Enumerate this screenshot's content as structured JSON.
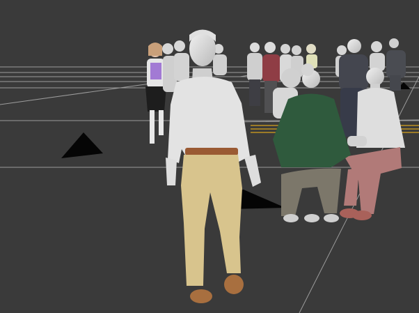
{
  "viewport": {
    "background_color": "#3a3a3a",
    "grid_color": "#bdbdbd",
    "selected_grid_color": "#d6a21c",
    "shadow_color": "#050505"
  },
  "characters": [
    {
      "name": "walking-man-foreground",
      "shirt_color": "#e3e3e3",
      "pants_color": "#d8c48d",
      "belt_color": "#9a5a33",
      "shoe_color": "#a86f3f"
    },
    {
      "name": "seated-woman-green-sweater",
      "top_color": "#2f5a3d",
      "pants_color": "#7c776a"
    },
    {
      "name": "seated-man-pink-pants",
      "shirt_color": "#dedede",
      "pants_color": "#b17a78"
    },
    {
      "name": "woman-purple-top",
      "top_color": "#a27ad4",
      "skirt_color": "#1d1d1d"
    },
    {
      "name": "man-red-shirt",
      "shirt_color": "#8f3d45"
    },
    {
      "name": "man-dark-sweater",
      "top_color": "#44464f",
      "pants_color": "#373b49"
    }
  ]
}
